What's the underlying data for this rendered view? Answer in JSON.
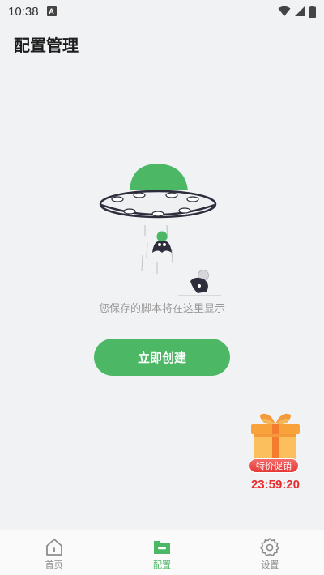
{
  "status_bar": {
    "time": "10:38",
    "app_icon_letter": "A"
  },
  "header": {
    "title": "配置管理"
  },
  "empty_state": {
    "message": "您保存的脚本将在这里显示",
    "create_button_label": "立即创建"
  },
  "promo": {
    "badge_label": "特价促销",
    "countdown": "23:59:20"
  },
  "bottom_nav": {
    "items": [
      {
        "label": "首页",
        "icon": "home-icon",
        "active": false
      },
      {
        "label": "配置",
        "icon": "folder-icon",
        "active": true
      },
      {
        "label": "设置",
        "icon": "gear-icon",
        "active": false
      }
    ]
  },
  "colors": {
    "accent": "#4cb865",
    "background": "#f1f2f4",
    "promo_red": "#e82c2c"
  }
}
